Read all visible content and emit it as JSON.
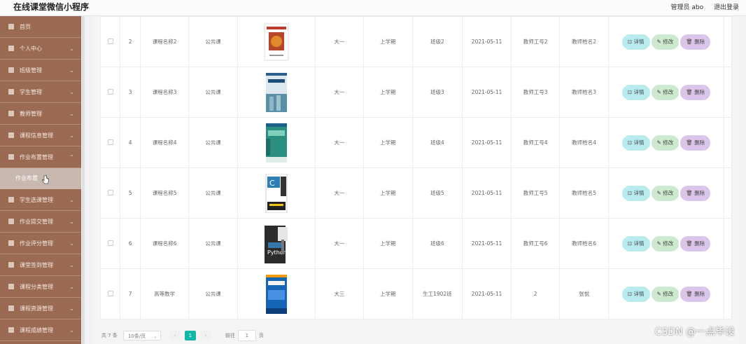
{
  "header": {
    "app_title": "在线课堂微信小程序",
    "user": "管理员 abo",
    "logout": "退出登录"
  },
  "sidebar": {
    "items": [
      {
        "label": "首页",
        "icon": "home-icon",
        "chevron": false
      },
      {
        "label": "个人中心",
        "icon": "user-icon",
        "chevron": true
      },
      {
        "label": "班级管理",
        "icon": "class-icon",
        "chevron": true
      },
      {
        "label": "学生管理",
        "icon": "student-icon",
        "chevron": true
      },
      {
        "label": "教师管理",
        "icon": "teacher-icon",
        "chevron": true
      },
      {
        "label": "课程信息管理",
        "icon": "course-icon",
        "chevron": true
      },
      {
        "label": "作业布置管理",
        "icon": "assignment-icon",
        "chevron": true,
        "expanded": true
      },
      {
        "label": "学生选课管理",
        "icon": "select-icon",
        "chevron": true
      },
      {
        "label": "作业提交管理",
        "icon": "submit-icon",
        "chevron": true
      },
      {
        "label": "作业评分管理",
        "icon": "grade-icon",
        "chevron": true
      },
      {
        "label": "课堂签到管理",
        "icon": "checkin-icon",
        "chevron": true
      },
      {
        "label": "课程分类管理",
        "icon": "category-icon",
        "chevron": true
      },
      {
        "label": "课程资源管理",
        "icon": "resource-icon",
        "chevron": true
      },
      {
        "label": "课程成绩管理",
        "icon": "score-icon",
        "chevron": true
      }
    ],
    "submenu_label": "作业布置"
  },
  "table": {
    "rows": [
      {
        "no": "2",
        "name": "课程名称2",
        "type": "公共课",
        "grade": "大一",
        "term": "上学期",
        "class": "班级2",
        "date": "2021-05-11",
        "teacher_no": "教师工号2",
        "teacher_name": "教师姓名2",
        "cover": "red"
      },
      {
        "no": "3",
        "name": "课程名称3",
        "type": "公共课",
        "grade": "大一",
        "term": "上学期",
        "class": "班级3",
        "date": "2021-05-11",
        "teacher_no": "教师工号3",
        "teacher_name": "教师姓名3",
        "cover": "blue"
      },
      {
        "no": "4",
        "name": "课程名称4",
        "type": "公共课",
        "grade": "大一",
        "term": "上学期",
        "class": "班级4",
        "date": "2021-05-11",
        "teacher_no": "教师工号4",
        "teacher_name": "教师姓名4",
        "cover": "teal"
      },
      {
        "no": "5",
        "name": "课程名称5",
        "type": "公共课",
        "grade": "大一",
        "term": "上学期",
        "class": "班级5",
        "date": "2021-05-11",
        "teacher_no": "教师工号5",
        "teacher_name": "教师姓名5",
        "cover": "c"
      },
      {
        "no": "6",
        "name": "课程名称6",
        "type": "公共课",
        "grade": "大一",
        "term": "上学期",
        "class": "班级6",
        "date": "2021-05-11",
        "teacher_no": "教师工号6",
        "teacher_name": "教师姓名6",
        "cover": "python"
      },
      {
        "no": "7",
        "name": "高等数学",
        "type": "公共课",
        "grade": "大三",
        "term": "上学期",
        "class": "生工1902班",
        "date": "2021-05-11",
        "teacher_no": "2",
        "teacher_name": "张悦",
        "cover": "math"
      }
    ],
    "actions": {
      "detail": "详情",
      "edit": "修改",
      "delete": "删除"
    }
  },
  "pager": {
    "total": "共 7 条",
    "page_size": "10条/页",
    "prev": "‹",
    "current": "1",
    "next": "›",
    "goto_label": "前往",
    "goto_value": "1",
    "page_suffix": "页"
  },
  "watermark": "CSDN @一点毕设",
  "colors": {
    "sidebar": "#9b6a52",
    "accent": "#12b7a6",
    "detail": "#b8ecef",
    "edit": "#cde9cf",
    "delete": "#d9c6ea"
  }
}
